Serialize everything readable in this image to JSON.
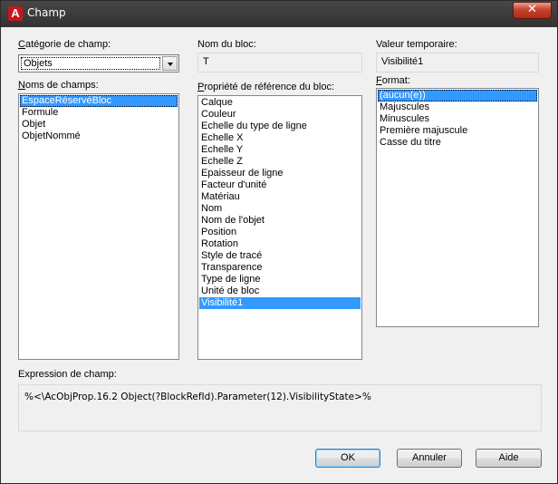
{
  "window": {
    "title": "Champ",
    "close_label": "✕"
  },
  "category": {
    "label": "Catégorie de champ:",
    "value": "Objets"
  },
  "field_names": {
    "label": "Noms de champs:",
    "items": [
      "EspaceRéservéBloc",
      "Formule",
      "Objet",
      "ObjetNommé"
    ],
    "selected_index": 0
  },
  "block_name": {
    "label": "Nom du bloc:",
    "value": "T"
  },
  "block_props": {
    "label": "Propriété de référence du bloc:",
    "items": [
      "Calque",
      "Couleur",
      "Echelle du type de ligne",
      "Echelle X",
      "Echelle Y",
      "Echelle Z",
      "Epaisseur de ligne",
      "Facteur d'unité",
      "Matériau",
      "Nom",
      "Nom de l'objet",
      "Position",
      "Rotation",
      "Style de tracé",
      "Transparence",
      "Type de ligne",
      "Unité de bloc",
      "Visibilité1"
    ],
    "selected_index": 17
  },
  "temp_value": {
    "label": "Valeur temporaire:",
    "value": "Visibilité1"
  },
  "format": {
    "label": "Format:",
    "items": [
      "(aucun(e))",
      "Majuscules",
      "Minuscules",
      "Première majuscule",
      "Casse du titre"
    ],
    "selected_index": 0
  },
  "expression": {
    "label": "Expression de champ:",
    "value": "%<\\AcObjProp.16.2 Object(?BlockRefId).Parameter(12).VisibilityState>%"
  },
  "buttons": {
    "ok": "OK",
    "cancel": "Annuler",
    "help": "Aide"
  }
}
